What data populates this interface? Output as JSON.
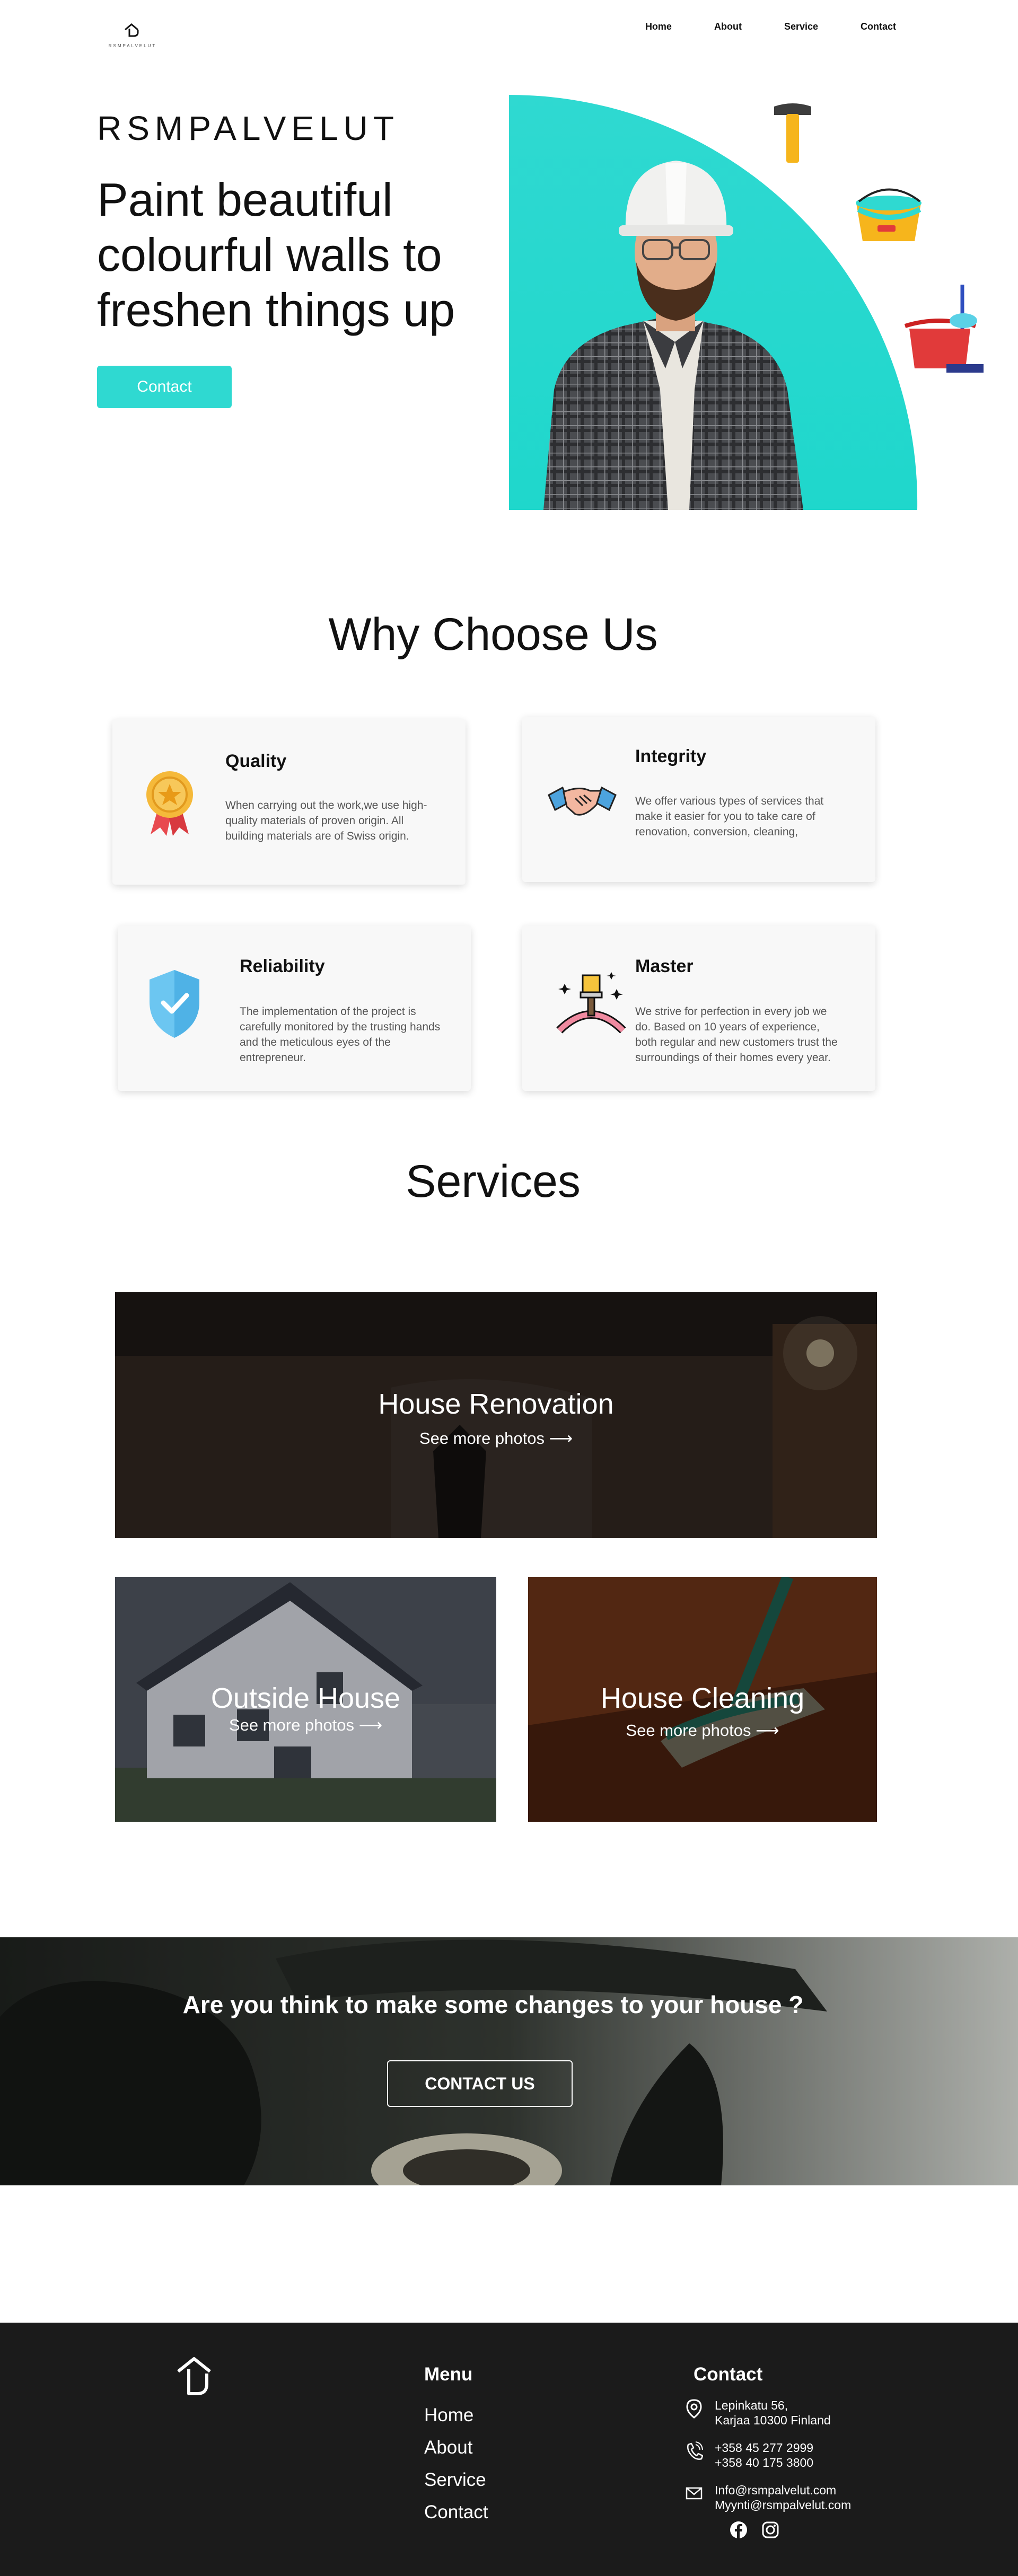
{
  "header": {
    "logo_text": "RSMPALVELUT",
    "nav": [
      "Home",
      "About",
      "Service",
      "Contact"
    ]
  },
  "hero": {
    "brand": "RSMPALVELUT",
    "headline_lines": [
      "Paint beautiful",
      "colourful walls to",
      "freshen things up"
    ],
    "button": "Contact"
  },
  "why": {
    "title": "Why Choose Us",
    "cards": [
      {
        "title": "Quality",
        "icon": "medal-icon",
        "text_lines": [
          "When carrying out the work,we use high-",
          "quality materials of proven origin. All",
          "building materials are of Swiss origin."
        ]
      },
      {
        "title": "Integrity",
        "icon": "handshake-icon",
        "text_lines": [
          "We offer various types of services that",
          "make it easier for you to take care of",
          "renovation, conversion, cleaning,"
        ]
      },
      {
        "title": "Reliability",
        "icon": "shield-check-icon",
        "text_lines": [
          "The implementation of the project is",
          "carefully monitored by the trusting hands",
          "and the meticulous eyes of the",
          "entrepreneur."
        ]
      },
      {
        "title": "Master",
        "icon": "paintbrush-star-icon",
        "text_lines": [
          "We strive for perfection in every job we",
          "do. Based on 10 years of experience,",
          "both regular and new customers trust the",
          "surroundings of their homes every year."
        ]
      }
    ]
  },
  "services": {
    "title": "Services",
    "items": [
      {
        "title": "House Renovation",
        "link": "See more photos"
      },
      {
        "title": "Outside House",
        "link": "See more photos"
      },
      {
        "title": "House Cleaning",
        "link": "See more photos"
      }
    ]
  },
  "cta": {
    "heading": "Are you think to make some changes to your house ?",
    "button": "CONTACT US"
  },
  "footer": {
    "menu_title": "Menu",
    "menu": [
      "Home",
      "About",
      "Service",
      "Contact"
    ],
    "contact_title": "Contact",
    "address": [
      "Lepinkatu 56,",
      "Karjaa 10300 Finland"
    ],
    "phones": [
      "+358 45 277 2999",
      "+358 40 175 3800"
    ],
    "emails": [
      "Info@rsmpalvelut.com",
      "Myynti@rsmpalvelut.com"
    ]
  },
  "colors": {
    "accent": "#2fd9d1",
    "footer_bg": "#1b1b1b",
    "text": "#111111"
  }
}
